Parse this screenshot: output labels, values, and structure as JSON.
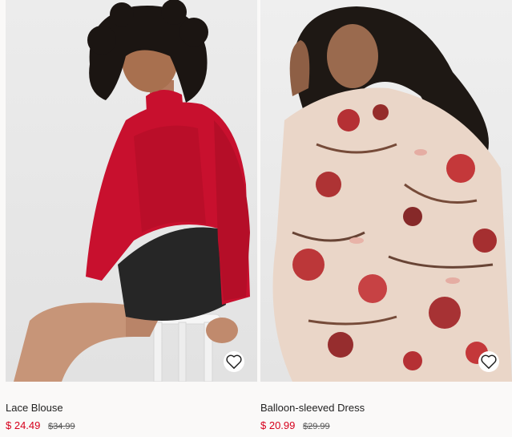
{
  "products": [
    {
      "name": "Lace Blouse",
      "price": "$ 24.49",
      "original_price": "$34.99",
      "image_alt": "model in red lace blouse and black leather skirt",
      "favorite_icon": "heart-outline-icon"
    },
    {
      "name": "Balloon-sleeved Dress",
      "price": "$ 20.99",
      "original_price": "$29.99",
      "image_alt": "model in floral balloon-sleeved dress",
      "favorite_icon": "heart-outline-icon"
    }
  ],
  "colors": {
    "sale_price": "#d6001c",
    "background": "#faf9f8",
    "text": "#222222"
  }
}
